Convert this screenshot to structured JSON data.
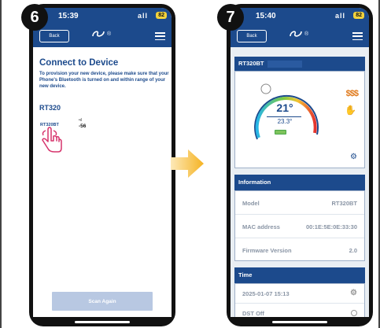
{
  "steps": {
    "first": "6",
    "second": "7"
  },
  "phone1": {
    "status": {
      "time": "15:39",
      "signal": "all",
      "battery": "82"
    },
    "nav": {
      "back": "Back",
      "logo_subtitle": "®"
    },
    "title": "Connect to Device",
    "description": "To provision your new device, please make sure that your Phone's Bluetooth is turned on and within range of your new device.",
    "section": "RT320",
    "device": {
      "name": "RT320BT",
      "rssi_icon": "•ıl",
      "rssi": "-56"
    },
    "scan_button": "Scan Again"
  },
  "phone2": {
    "status": {
      "time": "15:40",
      "signal": "all",
      "battery": "82"
    },
    "nav": {
      "back": "Back",
      "logo_subtitle": "®"
    },
    "device_card": {
      "title": "RT320BT",
      "set_temp": "21°",
      "room_temp": "23.3°",
      "heat_icon": "$$$",
      "touch_icon": "✋",
      "settings_icon": "⚙"
    },
    "information": {
      "header": "Information",
      "rows": [
        {
          "label": "Model",
          "value": "RT320BT"
        },
        {
          "label": "MAC address",
          "value": "00:1E:5E:0E:33:30"
        },
        {
          "label": "Firmware Version",
          "value": "2.0"
        }
      ]
    },
    "time": {
      "header": "Time",
      "date_time": "2025-01-07   15:13",
      "dst": "DST   Off",
      "gear": "⚙"
    }
  },
  "colors": {
    "brand": "#1c4a8c",
    "accent": "#f5b323",
    "heat": "#e07a1c",
    "touch": "#d6336c"
  }
}
